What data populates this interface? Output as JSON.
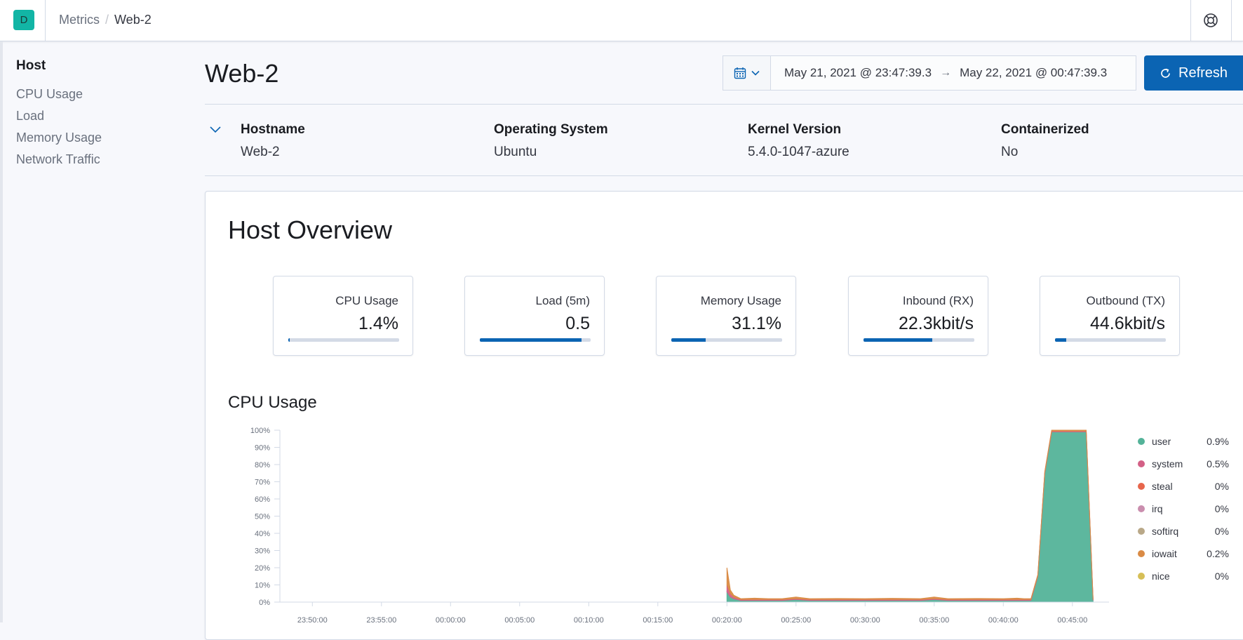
{
  "topbar": {
    "logo_letter": "D",
    "breadcrumb": [
      "Metrics",
      "Web-2"
    ]
  },
  "sidebar": {
    "title": "Host",
    "items": [
      "CPU Usage",
      "Load",
      "Memory Usage",
      "Network Traffic"
    ]
  },
  "page": {
    "title": "Web-2"
  },
  "datepicker": {
    "start": "May 21, 2021 @ 23:47:39.3",
    "arrow": "→",
    "end": "May 22, 2021 @ 00:47:39.3"
  },
  "refresh_button": {
    "label": "Refresh"
  },
  "metadata": [
    {
      "label": "Hostname",
      "value": "Web-2"
    },
    {
      "label": "Operating System",
      "value": "Ubuntu"
    },
    {
      "label": "Kernel Version",
      "value": "5.4.0-1047-azure"
    },
    {
      "label": "Containerized",
      "value": "No"
    }
  ],
  "overview": {
    "title": "Host Overview",
    "stats": [
      {
        "label": "CPU Usage",
        "value": "1.4%",
        "fill_fraction": 0.014
      },
      {
        "label": "Load (5m)",
        "value": "0.5",
        "fill_fraction": 0.92
      },
      {
        "label": "Memory Usage",
        "value": "31.1%",
        "fill_fraction": 0.311
      },
      {
        "label": "Inbound (RX)",
        "value": "22.3kbit/s",
        "fill_fraction": 0.62
      },
      {
        "label": "Outbound (TX)",
        "value": "44.6kbit/s",
        "fill_fraction": 0.1
      }
    ]
  },
  "cpu_section": {
    "title": "CPU Usage"
  },
  "colors": {
    "accent": "#0b64b3",
    "logo": "#12b5a5",
    "user": "#54b399",
    "system": "#d36086",
    "steal": "#e7664c",
    "irq": "#ca8eae",
    "softirq": "#b9a888",
    "iowait": "#da8b45",
    "nice": "#d6bf57"
  },
  "chart_data": {
    "type": "area",
    "title": "CPU Usage",
    "y_ticks": [
      "100%",
      "90%",
      "80%",
      "70%",
      "60%",
      "50%",
      "40%",
      "30%",
      "20%",
      "10%",
      "0%"
    ],
    "x_ticks": [
      "23:50:00",
      "23:55:00",
      "00:00:00",
      "00:05:00",
      "00:10:00",
      "00:15:00",
      "00:20:00",
      "00:25:00",
      "00:30:00",
      "00:35:00",
      "00:40:00",
      "00:45:00"
    ],
    "ylim": [
      0,
      100
    ],
    "xlim": [
      "23:47:39",
      "00:47:39"
    ],
    "grid": false,
    "legend_position": "right",
    "x": [
      "00:20:00",
      "00:20:15",
      "00:20:30",
      "00:21:00",
      "00:22:00",
      "00:23:00",
      "00:24:00",
      "00:25:00",
      "00:26:00",
      "00:28:00",
      "00:30:00",
      "00:32:00",
      "00:34:00",
      "00:35:00",
      "00:36:00",
      "00:38:00",
      "00:40:00",
      "00:41:00",
      "00:41:30",
      "00:42:00",
      "00:42:30",
      "00:43:00",
      "00:43:30",
      "00:44:00",
      "00:45:00",
      "00:46:00",
      "00:46:30"
    ],
    "series": [
      {
        "name": "user",
        "legend_value": "0.9%",
        "values": [
          6,
          3,
          2,
          1,
          1,
          1,
          1,
          1.5,
          1,
          1,
          1,
          1,
          1,
          1.5,
          1,
          1,
          1,
          1,
          1,
          1,
          15,
          75,
          99,
          99,
          99,
          99,
          1
        ]
      },
      {
        "name": "system",
        "legend_value": "0.5%",
        "values": [
          4,
          2,
          1,
          0.5,
          0.5,
          0.5,
          0.5,
          0.5,
          0.5,
          0.5,
          0.5,
          0.5,
          0.5,
          0.5,
          0.5,
          0.5,
          0.5,
          0.5,
          0.5,
          0.5,
          0.5,
          0.5,
          0.5,
          0.5,
          0.5,
          0.5,
          0.5
        ]
      },
      {
        "name": "steal",
        "legend_value": "0%",
        "values": [
          0,
          0,
          0,
          0,
          0,
          0,
          0,
          0,
          0,
          0,
          0,
          0,
          0,
          0,
          0,
          0,
          0,
          0,
          0,
          0,
          0,
          0,
          0,
          0,
          0,
          0,
          0
        ]
      },
      {
        "name": "irq",
        "legend_value": "0%",
        "values": [
          0,
          0,
          0,
          0,
          0,
          0,
          0,
          0,
          0,
          0,
          0,
          0,
          0,
          0,
          0,
          0,
          0,
          0,
          0,
          0,
          0,
          0,
          0,
          0,
          0,
          0,
          0
        ]
      },
      {
        "name": "softirq",
        "legend_value": "0%",
        "values": [
          0,
          0,
          0,
          0,
          0,
          0,
          0,
          0,
          0,
          0,
          0,
          0,
          0,
          0,
          0,
          0,
          0,
          0,
          0,
          0,
          0,
          0,
          0,
          0,
          0,
          0,
          0
        ]
      },
      {
        "name": "iowait",
        "legend_value": "0.2%",
        "values": [
          10,
          2,
          1,
          0.5,
          0.8,
          0.5,
          0.5,
          1,
          0.5,
          0.6,
          0.5,
          0.7,
          0.5,
          1,
          0.5,
          0.6,
          0.5,
          0.8,
          0.5,
          0.5,
          0.5,
          0.5,
          0.5,
          0.5,
          0.5,
          0.5,
          0.5
        ]
      },
      {
        "name": "nice",
        "legend_value": "0%",
        "values": [
          0,
          0,
          0,
          0,
          0,
          0,
          0,
          0,
          0,
          0,
          0,
          0,
          0,
          0,
          0,
          0,
          0,
          0,
          0,
          0,
          0,
          0,
          0,
          0,
          0,
          0,
          0
        ]
      }
    ]
  }
}
